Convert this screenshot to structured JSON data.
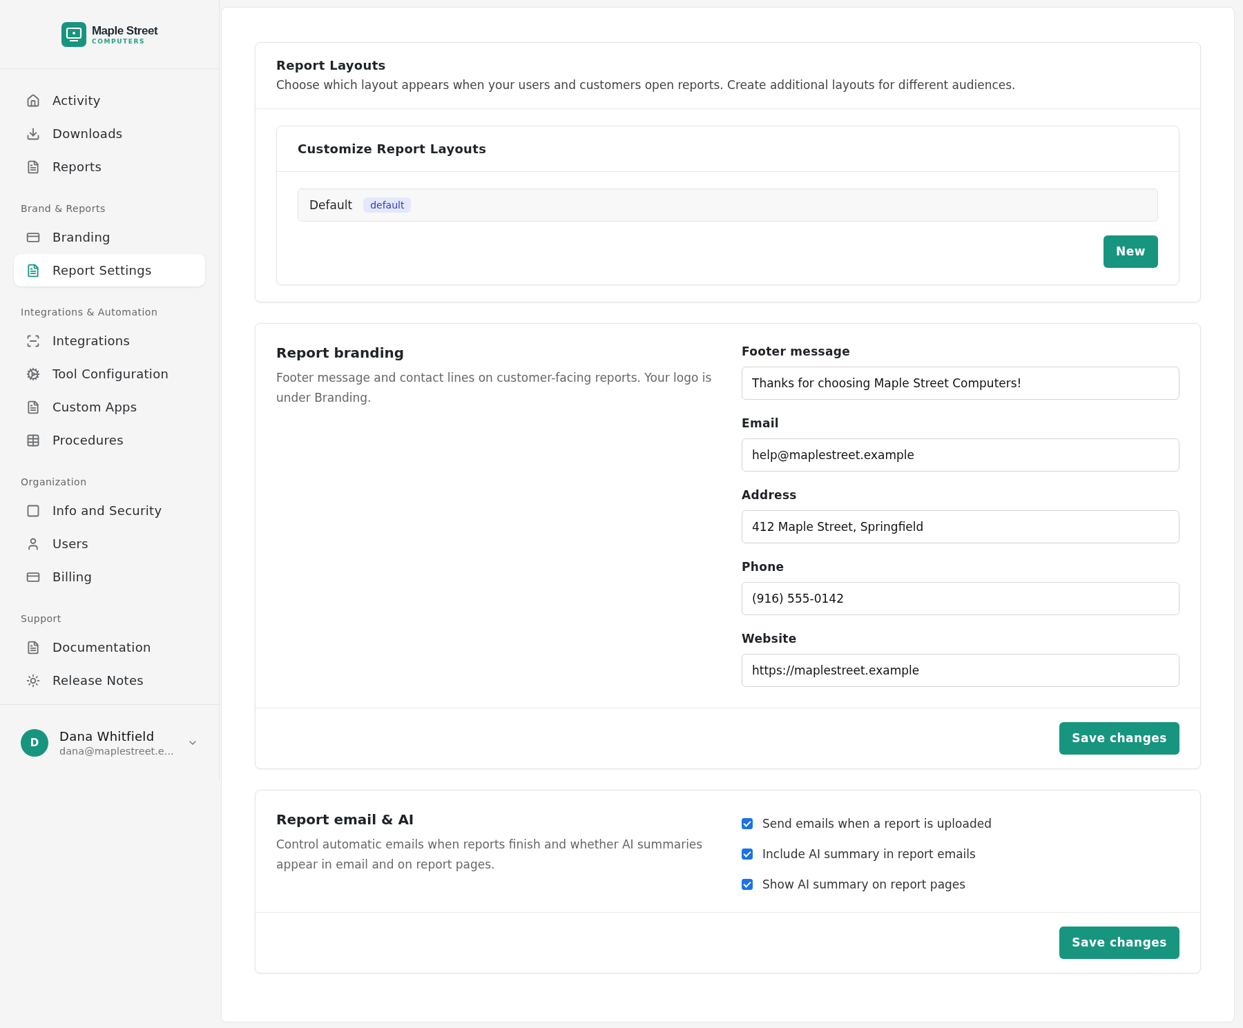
{
  "brand": {
    "name": "Maple Street",
    "tagline": "COMPUTERS"
  },
  "sidebar": {
    "sections": [
      {
        "items": [
          {
            "label": "Activity",
            "selected": false
          },
          {
            "label": "Downloads",
            "selected": false
          },
          {
            "label": "Reports",
            "selected": false
          }
        ]
      },
      {
        "title": "Brand & Reports",
        "items": [
          {
            "label": "Branding",
            "selected": false
          },
          {
            "label": "Report Settings",
            "selected": true
          }
        ]
      },
      {
        "title": "Integrations & Automation",
        "items": [
          {
            "label": "Integrations",
            "selected": false
          },
          {
            "label": "Tool Configuration",
            "selected": false
          },
          {
            "label": "Custom Apps",
            "selected": false
          },
          {
            "label": "Procedures",
            "selected": false
          }
        ]
      },
      {
        "title": "Organization",
        "items": [
          {
            "label": "Info and Security",
            "selected": false
          },
          {
            "label": "Users",
            "selected": false
          },
          {
            "label": "Billing",
            "selected": false
          }
        ]
      },
      {
        "title": "Support",
        "items": [
          {
            "label": "Documentation",
            "selected": false
          },
          {
            "label": "Release Notes",
            "selected": false
          }
        ]
      }
    ]
  },
  "user": {
    "initial": "D",
    "name": "Dana Whitfield",
    "email": "dana@maplestreet.e..."
  },
  "layouts": {
    "title": "Report Layouts",
    "description": "Choose which layout appears when your users and customers open reports. Create additional layouts for different audiences.",
    "panel_title": "Customize Report Layouts",
    "rows": [
      {
        "name": "Default",
        "badge": "default"
      }
    ],
    "new_button": "New"
  },
  "branding": {
    "title": "Report branding",
    "description": "Footer message and contact lines on customer-facing reports. Your logo is under Branding.",
    "fields": [
      {
        "label": "Footer message",
        "value": "Thanks for choosing Maple Street Computers!"
      },
      {
        "label": "Email",
        "value": "help@maplestreet.example"
      },
      {
        "label": "Address",
        "value": "412 Maple Street, Springfield"
      },
      {
        "label": "Phone",
        "value": "(916) 555-0142"
      },
      {
        "label": "Website",
        "value": "https://maplestreet.example"
      }
    ],
    "save_button": "Save changes"
  },
  "email_ai": {
    "title": "Report email & AI",
    "description": "Control automatic emails when reports finish and whether AI summaries appear in email and on report pages.",
    "options": [
      {
        "label": "Send emails when a report is uploaded",
        "checked": true
      },
      {
        "label": "Include AI summary in report emails",
        "checked": true
      },
      {
        "label": "Show AI summary on report pages",
        "checked": true
      }
    ],
    "save_button": "Save changes"
  }
}
